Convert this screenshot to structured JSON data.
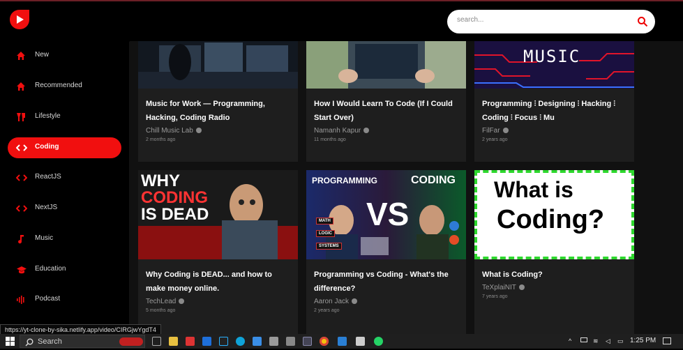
{
  "colors": {
    "accent": "#f10f0f",
    "background": "#000000",
    "card": "#1e1e1e",
    "feed": "#111111"
  },
  "header": {
    "logo_icon": "play-logo-icon",
    "search_placeholder": "search...",
    "search_icon": "search-icon"
  },
  "sidebar": {
    "items": [
      {
        "label": "New",
        "icon": "home-icon",
        "active": false
      },
      {
        "label": "Recommended",
        "icon": "home-icon",
        "active": false
      },
      {
        "label": "Lifestyle",
        "icon": "lifestyle-icon",
        "active": false
      },
      {
        "label": "Coding",
        "icon": "code-icon",
        "active": true
      },
      {
        "label": "ReactJS",
        "icon": "code-icon",
        "active": false
      },
      {
        "label": "NextJS",
        "icon": "code-icon",
        "active": false
      },
      {
        "label": "Music",
        "icon": "music-note-icon",
        "active": false
      },
      {
        "label": "Education",
        "icon": "graduation-cap-icon",
        "active": false
      },
      {
        "label": "Podcast",
        "icon": "podcast-icon",
        "active": false
      }
    ]
  },
  "videos": [
    {
      "title": "Music for Work — Programming, Hacking, Coding Radio",
      "channel": "Chill Music Lab",
      "time": "2 months ago",
      "thumb_text": ""
    },
    {
      "title": "How I Would Learn To Code (If I Could Start Over)",
      "channel": "Namanh Kapur",
      "time": "11 months ago",
      "thumb_text": ""
    },
    {
      "title": "Programming ⫶ Designing ⫶ Hacking ⫶ Coding ⫶ Focus ⫶ Mu",
      "channel": "FilFar",
      "time": "2 years ago",
      "thumb_text": "MUSIC"
    },
    {
      "title": "Why Coding is DEAD... and how to make money online.",
      "channel": "TechLead",
      "time": "5 months ago",
      "thumb_text_1": "WHY",
      "thumb_text_2": "CODING",
      "thumb_text_3": "IS DEAD"
    },
    {
      "title": "Programming vs Coding - What's the difference?",
      "channel": "Aaron Jack",
      "time": "2 years ago",
      "thumb_text_1": "PROGRAMMING",
      "thumb_text_2": "CODING",
      "thumb_text_3": "VS",
      "thumb_tags": [
        "MATH",
        "LOGIC",
        "SYSTEMS"
      ]
    },
    {
      "title": "What is Coding?",
      "channel": "TeXplaiNIT",
      "time": "7 years ago",
      "thumb_text_1": "What is",
      "thumb_text_2": "Coding?"
    }
  ],
  "status_url": "https://yt-clone-by-sika.netlify.app/video/CIRGjwYgdT4",
  "taskbar": {
    "search_label": "Search",
    "time": "1:25 PM"
  }
}
